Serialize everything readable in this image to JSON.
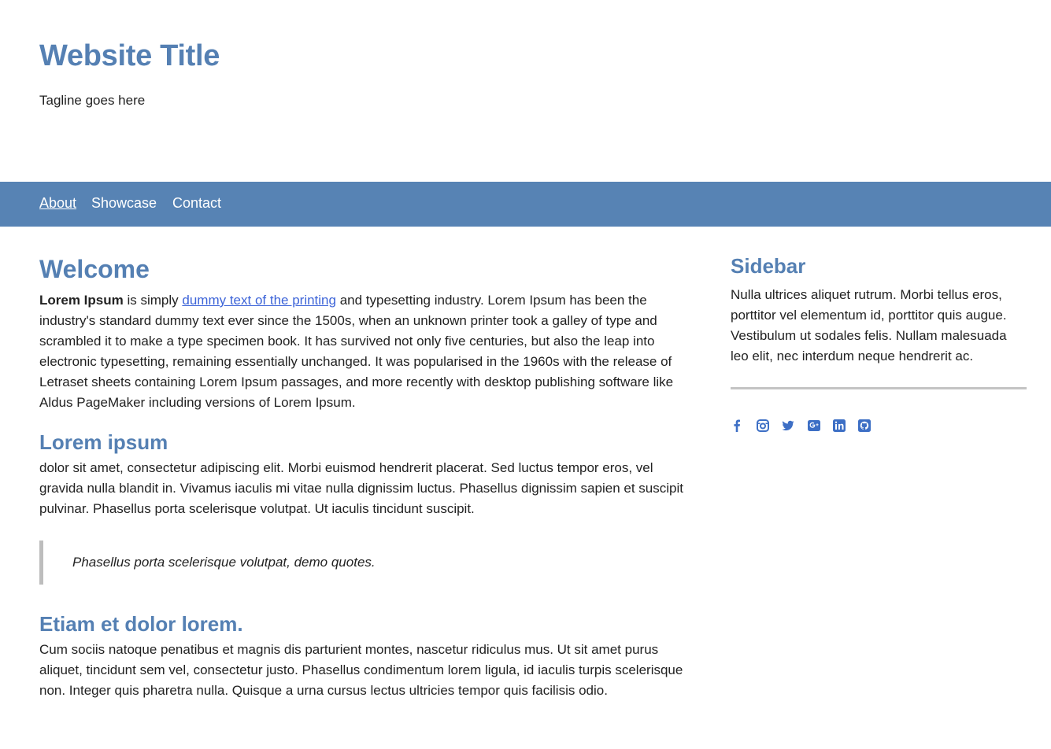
{
  "header": {
    "title": "Website Title",
    "tagline": "Tagline goes here"
  },
  "nav": {
    "items": [
      {
        "label": "About",
        "active": true
      },
      {
        "label": "Showcase",
        "active": false
      },
      {
        "label": "Contact",
        "active": false
      }
    ]
  },
  "main": {
    "welcome_heading": "Welcome",
    "intro": {
      "bold": "Lorem Ipsum",
      "pre_link": " is simply ",
      "link_text": "dummy text of the printing",
      "post_link": " and typesetting industry. Lorem Ipsum has been the industry's standard dummy text ever since the 1500s, when an unknown printer took a galley of type and scrambled it to make a type specimen book. It has survived not only five centuries, but also the leap into electronic typesetting, remaining essentially unchanged. It was popularised in the 1960s with the release of Letraset sheets containing Lorem Ipsum passages, and more recently with desktop publishing software like Aldus PageMaker including versions of Lorem Ipsum."
    },
    "section2_heading": "Lorem ipsum",
    "section2_body": "dolor sit amet, consectetur adipiscing elit. Morbi euismod hendrerit placerat. Sed luctus tempor eros, vel gravida nulla blandit in. Vivamus iaculis mi vitae nulla dignissim luctus. Phasellus dignissim sapien et suscipit pulvinar. Phasellus porta scelerisque volutpat. Ut iaculis tincidunt suscipit.",
    "quote": "Phasellus porta scelerisque volutpat, demo quotes.",
    "section3_heading": "Etiam et dolor lorem.",
    "section3_body": "Cum sociis natoque penatibus et magnis dis parturient montes, nascetur ridiculus mus. Ut sit amet purus aliquet, tincidunt sem vel, consectetur justo. Phasellus condimentum lorem ligula, id iaculis turpis scelerisque non. Integer quis pharetra nulla. Quisque a urna cursus lectus ultricies tempor quis facilisis odio."
  },
  "sidebar": {
    "title": "Sidebar",
    "body": "Nulla ultrices aliquet rutrum. Morbi tellus eros, porttitor vel elementum id, porttitor quis augue. Vestibulum ut sodales felis. Nullam malesuada leo elit, nec interdum neque hendrerit ac.",
    "social_icons": [
      "facebook-icon",
      "instagram-icon",
      "twitter-icon",
      "google-plus-icon",
      "linkedin-icon",
      "github-icon"
    ]
  },
  "colors": {
    "accent": "#5580b3",
    "navbar": "#5783b4",
    "link": "#3d64d8",
    "icon": "#3d6fc5"
  }
}
